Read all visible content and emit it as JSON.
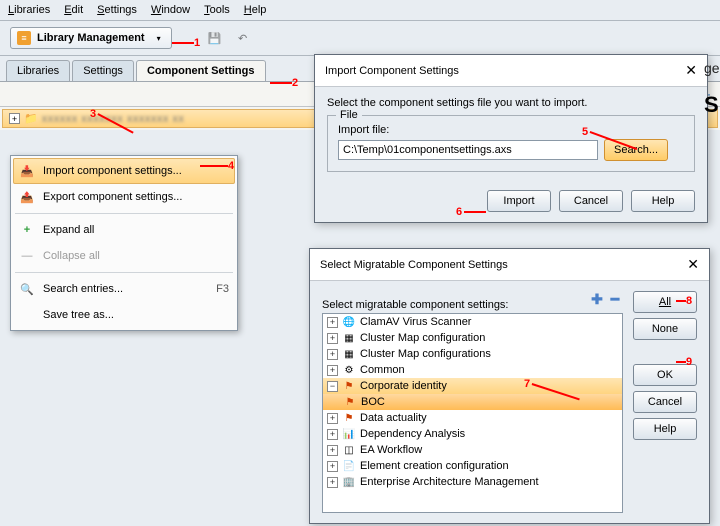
{
  "menu": {
    "items": [
      "Libraries",
      "Edit",
      "Settings",
      "Window",
      "Tools",
      "Help"
    ]
  },
  "toolbar": {
    "libmgmt": "Library Management"
  },
  "tabs": {
    "t0": "Libraries",
    "t1": "Settings",
    "t2": "Component Settings"
  },
  "ctx": {
    "importcs": "Import component settings...",
    "exportcs": "Export component settings...",
    "expand": "Expand all",
    "collapse": "Collapse all",
    "search": "Search entries...",
    "search_sc": "F3",
    "savetree": "Save tree as..."
  },
  "dlg_import": {
    "title": "Import Component Settings",
    "instr": "Select the component settings file you want to import.",
    "file_legend": "File",
    "file_label": "Import file:",
    "file_value": "C:\\Temp\\01componentsettings.axs",
    "search_btn": "Search...",
    "import_btn": "Import",
    "cancel_btn": "Cancel",
    "help_btn": "Help"
  },
  "dlg_select": {
    "title": "Select Migratable Component Settings",
    "instr": "Select migratable component settings:",
    "all_btn": "All",
    "none_btn": "None",
    "ok_btn": "OK",
    "cancel_btn": "Cancel",
    "help_btn": "Help",
    "items": {
      "i0": "ClamAV Virus Scanner",
      "i1": "Cluster Map configuration",
      "i2": "Cluster Map configurations",
      "i3": "Common",
      "i4": "Corporate identity",
      "i5": "BOC",
      "i6": "Data actuality",
      "i7": "Dependency Analysis",
      "i8": "EA Workflow",
      "i9": "Element creation configuration",
      "i10": "Enterprise Architecture Management"
    }
  },
  "annotations": {
    "a1": "1",
    "a2": "2",
    "a3": "3",
    "a4": "4",
    "a5": "5",
    "a6": "6",
    "a7": "7",
    "a8": "8",
    "a9": "9"
  }
}
